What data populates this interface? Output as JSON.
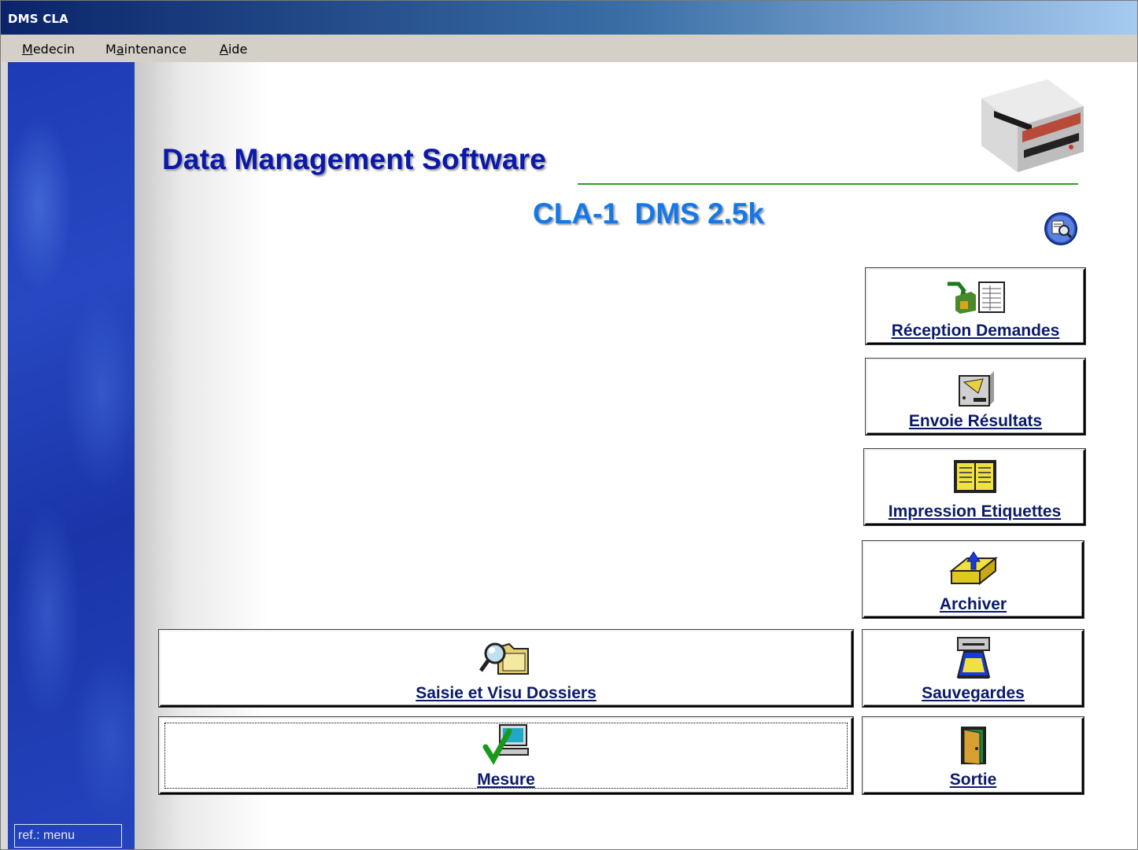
{
  "window": {
    "title": "DMS CLA"
  },
  "menu": {
    "items": [
      {
        "label": "Medecin",
        "accel_index": 0
      },
      {
        "label": "Maintenance",
        "accel_index": 1
      },
      {
        "label": "Aide",
        "accel_index": 0
      }
    ]
  },
  "header": {
    "title": "Data Management Software",
    "subtitle": "CLA-1  DMS 2.5k"
  },
  "status": {
    "ref_text": "ref.: menu"
  },
  "colors": {
    "title": "#0a19a8",
    "subtitle": "#1478e8",
    "button_text": "#0a1a6a",
    "accent_line": "#2f9e2f",
    "sidebar": "#2748c2"
  },
  "buttons": {
    "reception": {
      "label": "Réception Demandes",
      "icon": "receive-requests-icon"
    },
    "envoie": {
      "label": "Envoie Résultats",
      "icon": "send-results-icon"
    },
    "impression": {
      "label": "Impression Etiquettes",
      "icon": "print-labels-icon"
    },
    "archiver": {
      "label": "Archiver",
      "icon": "archive-icon"
    },
    "saisie": {
      "label": "Saisie et Visu Dossiers",
      "icon": "folder-search-icon"
    },
    "sauvegardes": {
      "label": "Sauvegardes",
      "icon": "backup-drive-icon"
    },
    "mesure": {
      "label": "Mesure",
      "icon": "measure-computer-icon"
    },
    "sortie": {
      "label": "Sortie",
      "icon": "exit-door-icon"
    }
  }
}
